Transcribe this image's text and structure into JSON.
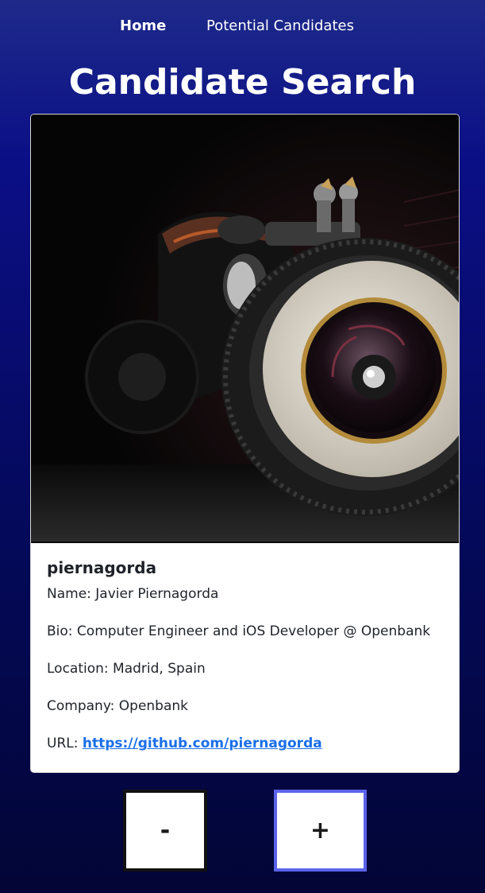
{
  "nav": {
    "home_label": "Home",
    "candidates_label": "Potential Candidates"
  },
  "page": {
    "title": "Candidate Search"
  },
  "candidate": {
    "avatar_icon": "hot-rod-car-photo",
    "username": "piernagorda",
    "name_label": "Name: ",
    "name": "Javier Piernagorda",
    "bio_label": "Bio: ",
    "bio": "Computer Engineer and iOS Developer @ Openbank",
    "location_label": "Location: ",
    "location": "Madrid, Spain",
    "company_label": "Company: ",
    "company": "Openbank",
    "url_label": "URL: ",
    "url": "https://github.com/piernagorda"
  },
  "actions": {
    "reject_label": "-",
    "accept_label": "+"
  },
  "colors": {
    "link": "#1a6fe8",
    "accept_border": "#5b63ea",
    "reject_border": "#111111"
  }
}
